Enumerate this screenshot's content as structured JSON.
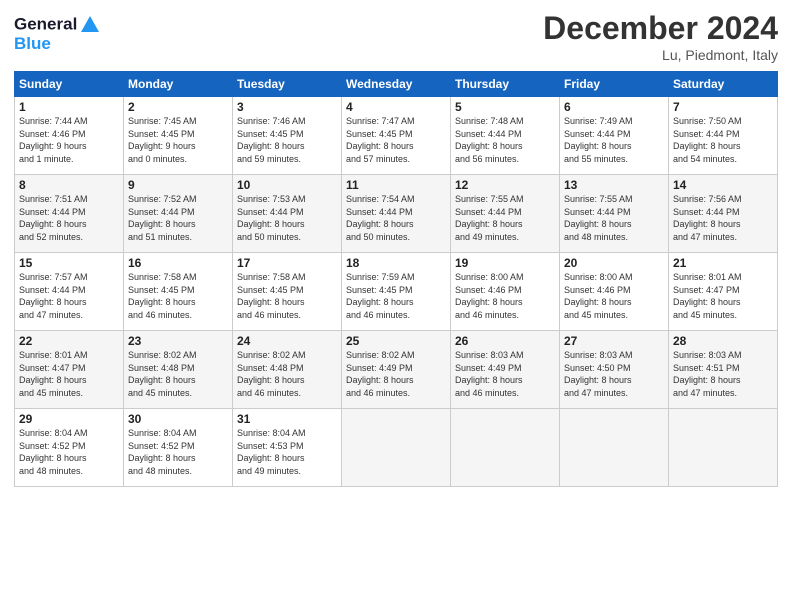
{
  "header": {
    "logo_line1": "General",
    "logo_line2": "Blue",
    "month": "December 2024",
    "location": "Lu, Piedmont, Italy"
  },
  "weekdays": [
    "Sunday",
    "Monday",
    "Tuesday",
    "Wednesday",
    "Thursday",
    "Friday",
    "Saturday"
  ],
  "weeks": [
    [
      {
        "day": "1",
        "info": "Sunrise: 7:44 AM\nSunset: 4:46 PM\nDaylight: 9 hours\nand 1 minute."
      },
      {
        "day": "2",
        "info": "Sunrise: 7:45 AM\nSunset: 4:45 PM\nDaylight: 9 hours\nand 0 minutes."
      },
      {
        "day": "3",
        "info": "Sunrise: 7:46 AM\nSunset: 4:45 PM\nDaylight: 8 hours\nand 59 minutes."
      },
      {
        "day": "4",
        "info": "Sunrise: 7:47 AM\nSunset: 4:45 PM\nDaylight: 8 hours\nand 57 minutes."
      },
      {
        "day": "5",
        "info": "Sunrise: 7:48 AM\nSunset: 4:44 PM\nDaylight: 8 hours\nand 56 minutes."
      },
      {
        "day": "6",
        "info": "Sunrise: 7:49 AM\nSunset: 4:44 PM\nDaylight: 8 hours\nand 55 minutes."
      },
      {
        "day": "7",
        "info": "Sunrise: 7:50 AM\nSunset: 4:44 PM\nDaylight: 8 hours\nand 54 minutes."
      }
    ],
    [
      {
        "day": "8",
        "info": "Sunrise: 7:51 AM\nSunset: 4:44 PM\nDaylight: 8 hours\nand 52 minutes."
      },
      {
        "day": "9",
        "info": "Sunrise: 7:52 AM\nSunset: 4:44 PM\nDaylight: 8 hours\nand 51 minutes."
      },
      {
        "day": "10",
        "info": "Sunrise: 7:53 AM\nSunset: 4:44 PM\nDaylight: 8 hours\nand 50 minutes."
      },
      {
        "day": "11",
        "info": "Sunrise: 7:54 AM\nSunset: 4:44 PM\nDaylight: 8 hours\nand 50 minutes."
      },
      {
        "day": "12",
        "info": "Sunrise: 7:55 AM\nSunset: 4:44 PM\nDaylight: 8 hours\nand 49 minutes."
      },
      {
        "day": "13",
        "info": "Sunrise: 7:55 AM\nSunset: 4:44 PM\nDaylight: 8 hours\nand 48 minutes."
      },
      {
        "day": "14",
        "info": "Sunrise: 7:56 AM\nSunset: 4:44 PM\nDaylight: 8 hours\nand 47 minutes."
      }
    ],
    [
      {
        "day": "15",
        "info": "Sunrise: 7:57 AM\nSunset: 4:44 PM\nDaylight: 8 hours\nand 47 minutes."
      },
      {
        "day": "16",
        "info": "Sunrise: 7:58 AM\nSunset: 4:45 PM\nDaylight: 8 hours\nand 46 minutes."
      },
      {
        "day": "17",
        "info": "Sunrise: 7:58 AM\nSunset: 4:45 PM\nDaylight: 8 hours\nand 46 minutes."
      },
      {
        "day": "18",
        "info": "Sunrise: 7:59 AM\nSunset: 4:45 PM\nDaylight: 8 hours\nand 46 minutes."
      },
      {
        "day": "19",
        "info": "Sunrise: 8:00 AM\nSunset: 4:46 PM\nDaylight: 8 hours\nand 46 minutes."
      },
      {
        "day": "20",
        "info": "Sunrise: 8:00 AM\nSunset: 4:46 PM\nDaylight: 8 hours\nand 45 minutes."
      },
      {
        "day": "21",
        "info": "Sunrise: 8:01 AM\nSunset: 4:47 PM\nDaylight: 8 hours\nand 45 minutes."
      }
    ],
    [
      {
        "day": "22",
        "info": "Sunrise: 8:01 AM\nSunset: 4:47 PM\nDaylight: 8 hours\nand 45 minutes."
      },
      {
        "day": "23",
        "info": "Sunrise: 8:02 AM\nSunset: 4:48 PM\nDaylight: 8 hours\nand 45 minutes."
      },
      {
        "day": "24",
        "info": "Sunrise: 8:02 AM\nSunset: 4:48 PM\nDaylight: 8 hours\nand 46 minutes."
      },
      {
        "day": "25",
        "info": "Sunrise: 8:02 AM\nSunset: 4:49 PM\nDaylight: 8 hours\nand 46 minutes."
      },
      {
        "day": "26",
        "info": "Sunrise: 8:03 AM\nSunset: 4:49 PM\nDaylight: 8 hours\nand 46 minutes."
      },
      {
        "day": "27",
        "info": "Sunrise: 8:03 AM\nSunset: 4:50 PM\nDaylight: 8 hours\nand 47 minutes."
      },
      {
        "day": "28",
        "info": "Sunrise: 8:03 AM\nSunset: 4:51 PM\nDaylight: 8 hours\nand 47 minutes."
      }
    ],
    [
      {
        "day": "29",
        "info": "Sunrise: 8:04 AM\nSunset: 4:52 PM\nDaylight: 8 hours\nand 48 minutes."
      },
      {
        "day": "30",
        "info": "Sunrise: 8:04 AM\nSunset: 4:52 PM\nDaylight: 8 hours\nand 48 minutes."
      },
      {
        "day": "31",
        "info": "Sunrise: 8:04 AM\nSunset: 4:53 PM\nDaylight: 8 hours\nand 49 minutes."
      },
      null,
      null,
      null,
      null
    ]
  ]
}
